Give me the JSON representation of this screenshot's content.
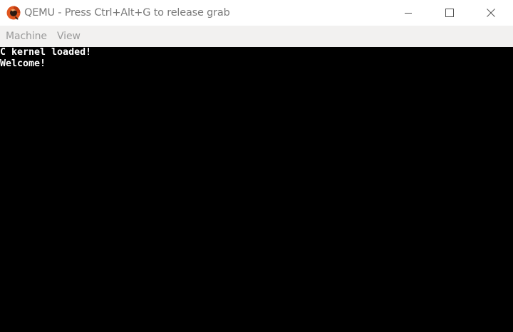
{
  "window": {
    "title": "QEMU - Press Ctrl+Alt+G to release grab",
    "icon": "qemu-logo-icon",
    "controls": {
      "minimize_icon": "minimize-icon",
      "maximize_icon": "maximize-icon",
      "close_icon": "close-icon"
    }
  },
  "menubar": {
    "items": [
      {
        "label": "Machine"
      },
      {
        "label": "View"
      }
    ]
  },
  "console": {
    "lines": [
      "C kernel loaded!",
      "Welcome!"
    ]
  },
  "colors": {
    "title_text": "#7a7a7a",
    "menubar_bg": "#f2f1f0",
    "menu_text": "#9a9a9a",
    "screen_bg": "#000000",
    "console_text": "#ffffff",
    "logo_orange": "#e0561f"
  }
}
